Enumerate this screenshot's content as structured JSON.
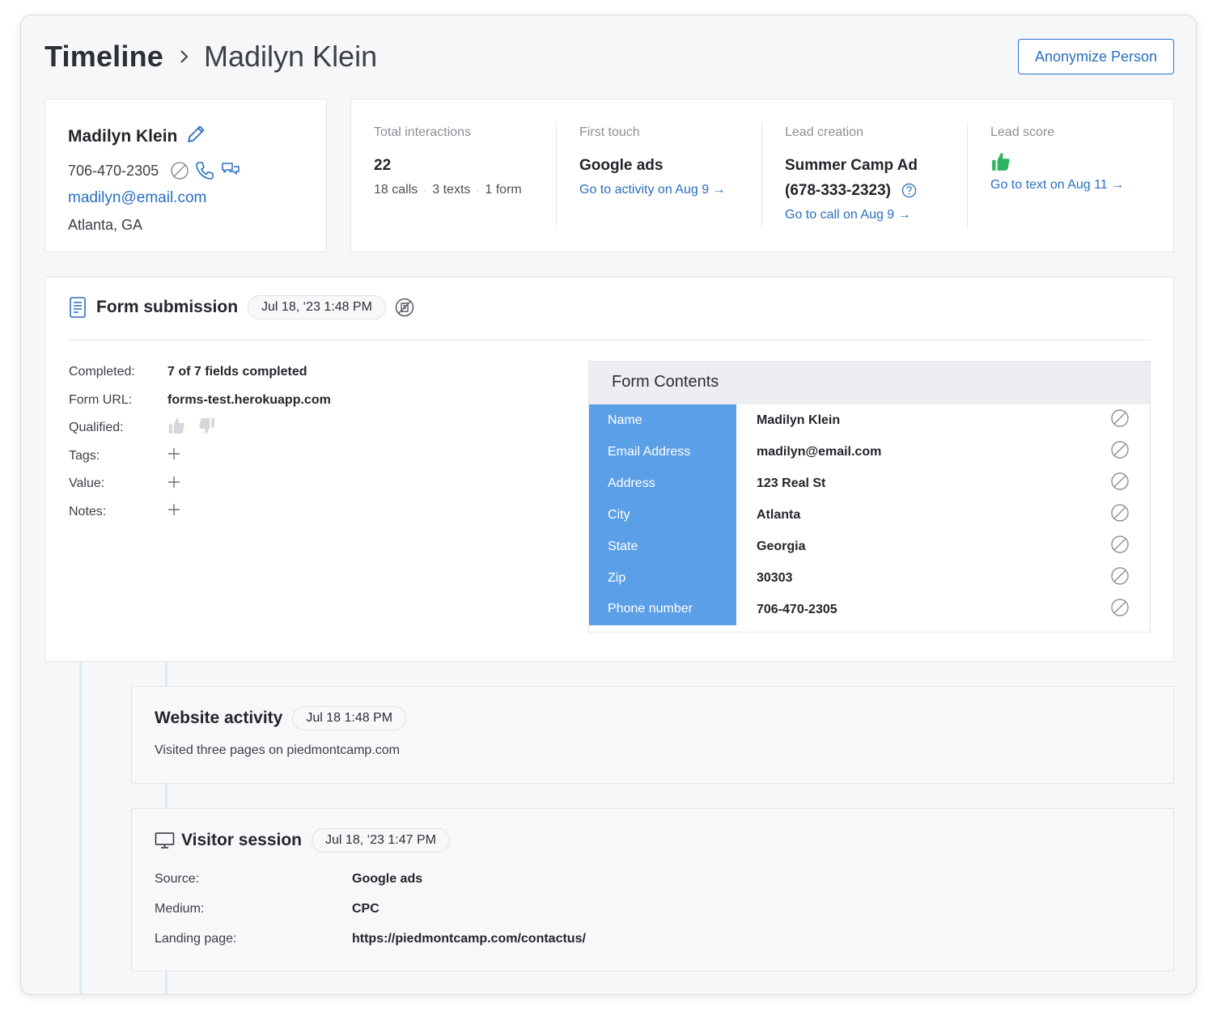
{
  "header": {
    "breadcrumb_root": "Timeline",
    "breadcrumb_leaf": "Madilyn Klein",
    "anonymize_label": "Anonymize Person"
  },
  "person": {
    "name": "Madilyn Klein",
    "phone": "706-470-2305",
    "email": "madilyn@email.com",
    "location": "Atlanta, GA"
  },
  "stats": {
    "total": {
      "label": "Total interactions",
      "value": "22",
      "calls": "18 calls",
      "texts": "3 texts",
      "forms": "1 form"
    },
    "first_touch": {
      "label": "First touch",
      "value": "Google ads",
      "link": "Go to activity on Aug 9 →"
    },
    "lead_creation": {
      "label": "Lead creation",
      "value_line1": "Summer Camp Ad",
      "value_line2": "(678-333-2323)",
      "link": "Go to call on Aug 9 →"
    },
    "lead_score": {
      "label": "Lead score",
      "link": "Go to text on Aug 11 →"
    }
  },
  "form_submission": {
    "title": "Form submission",
    "timestamp": "Jul 18, ‘23   1:48 PM",
    "fields": [
      {
        "label": "Completed:",
        "value": "7 of 7 fields completed"
      },
      {
        "label": "Form URL:",
        "value": "forms-test.herokuapp.com"
      },
      {
        "label": "Qualified:"
      },
      {
        "label": "Tags:"
      },
      {
        "label": "Value:"
      },
      {
        "label": "Notes:"
      }
    ],
    "contents_title": "Form Contents",
    "contents": [
      {
        "key": "Name",
        "value": "Madilyn Klein"
      },
      {
        "key": "Email Address",
        "value": "madilyn@email.com"
      },
      {
        "key": "Address",
        "value": "123 Real St"
      },
      {
        "key": "City",
        "value": "Atlanta"
      },
      {
        "key": "State",
        "value": "Georgia"
      },
      {
        "key": "Zip",
        "value": "30303"
      },
      {
        "key": "Phone number",
        "value": "706-470-2305"
      }
    ]
  },
  "website_activity": {
    "title": "Website activity",
    "timestamp": "Jul 18   1:48 PM",
    "description": "Visited three pages on piedmontcamp.com"
  },
  "visitor_session": {
    "title": "Visitor session",
    "timestamp": "Jul 18, ‘23   1:47 PM",
    "rows": [
      {
        "label": "Source:",
        "value": "Google ads"
      },
      {
        "label": "Medium:",
        "value": "CPC"
      },
      {
        "label": "Landing page:",
        "value": "https://piedmontcamp.com/contactus/"
      }
    ]
  },
  "colors": {
    "accent": "#2a6fc0",
    "table_key": "#5b9fe6",
    "thumb_positive": "#2fb463"
  }
}
